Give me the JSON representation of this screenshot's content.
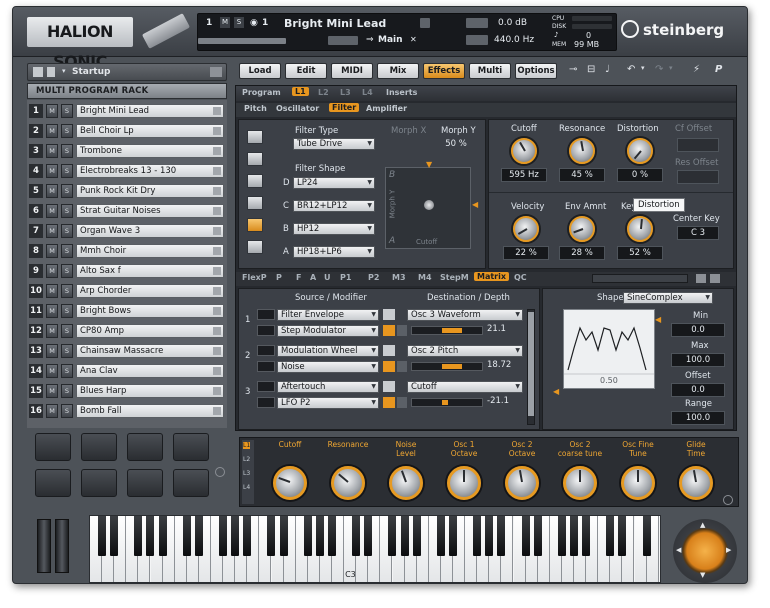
{
  "header": {
    "logo": "HALION SONIC",
    "slot_number": "1",
    "m_label": "M",
    "s_label": "S",
    "midi_channel": "1",
    "program_name": "Bright Mini Lead",
    "output": "Main",
    "level_db": "0.0 dB",
    "tune_hz": "440.0 Hz",
    "cpu_label": "CPU",
    "disk_label": "DISK",
    "midi_count": "0",
    "mem_label": "MEM",
    "mem_value": "99 MB",
    "brand": "steinberg"
  },
  "rack": {
    "preset_name": "Startup",
    "title": "MULTI PROGRAM RACK",
    "m_label": "M",
    "s_label": "S",
    "slots": [
      {
        "num": "1",
        "name": "Bright Mini Lead"
      },
      {
        "num": "2",
        "name": "Bell Choir Lp"
      },
      {
        "num": "3",
        "name": "Trombone"
      },
      {
        "num": "4",
        "name": "Electrobreaks 13 - 130"
      },
      {
        "num": "5",
        "name": "Punk Rock Kit Dry"
      },
      {
        "num": "6",
        "name": "Strat Guitar Noises"
      },
      {
        "num": "7",
        "name": "Organ Wave 3"
      },
      {
        "num": "8",
        "name": "Mmh Choir"
      },
      {
        "num": "9",
        "name": "Alto Sax f"
      },
      {
        "num": "10",
        "name": "Arp Chorder"
      },
      {
        "num": "11",
        "name": "Bright Bows"
      },
      {
        "num": "12",
        "name": "CP80 Amp"
      },
      {
        "num": "13",
        "name": "Chainsaw Massacre"
      },
      {
        "num": "14",
        "name": "Ana Clav"
      },
      {
        "num": "15",
        "name": "Blues Harp"
      },
      {
        "num": "16",
        "name": "Bomb Fall"
      }
    ]
  },
  "tabs": [
    "Load",
    "Edit",
    "MIDI",
    "Mix",
    "Effects",
    "Multi",
    "Options"
  ],
  "active_tab": "Effects",
  "editor": {
    "program_label": "Program",
    "layer_tabs": [
      "L1",
      "L2",
      "L3",
      "L4"
    ],
    "inserts_label": "Inserts",
    "sub_tabs": [
      "Pitch",
      "Oscillator",
      "Filter",
      "Amplifier"
    ],
    "active_sub_tab": "Filter",
    "filter_type_label": "Filter Type",
    "filter_type_value": "Tube Drive",
    "morph_x_label": "Morph X",
    "morph_y_label": "Morph Y",
    "morph_y_value": "50 %",
    "filter_shape_label": "Filter Shape",
    "shapes": [
      {
        "letter": "D",
        "value": "LP24"
      },
      {
        "letter": "C",
        "value": "BR12+LP12"
      },
      {
        "letter": "B",
        "value": "HP12"
      },
      {
        "letter": "A",
        "value": "HP18+LP6"
      }
    ],
    "xy_letters": [
      "B",
      "A"
    ],
    "xy_axis_y": "Morph Y",
    "xy_axis_x": "Cutoff",
    "knobs_top": [
      {
        "label": "Cutoff",
        "value": "595 Hz"
      },
      {
        "label": "Resonance",
        "value": "45 %"
      },
      {
        "label": "Distortion",
        "value": "0 %"
      }
    ],
    "cf_offset": "Cf Offset",
    "res_offset": "Res Offset",
    "knobs_bottom": [
      {
        "label": "Velocity",
        "value": "22 %"
      },
      {
        "label": "Env Amnt",
        "value": "28 %"
      },
      {
        "label": "Key",
        "value": "52 %"
      }
    ],
    "tooltip": "Distortion",
    "center_key_label": "Center Key",
    "center_key_value": "C 3",
    "mod_tabs": [
      "FlexP",
      "P",
      "F",
      "A",
      "U",
      "P1",
      "P2",
      "M3",
      "M4",
      "StepM",
      "Matrix",
      "QC"
    ],
    "active_mod_tab": "Matrix",
    "matrix": {
      "source_header": "Source / Modifier",
      "dest_header": "Destination / Depth",
      "rows": [
        {
          "num": "1",
          "source": "Filter Envelope",
          "modifier": "Step Modulator",
          "dest": "Osc 3 Waveform",
          "depth": "21.1"
        },
        {
          "num": "2",
          "source": "Modulation Wheel",
          "modifier": "Noise",
          "dest": "Osc 2 Pitch",
          "depth": "18.72"
        },
        {
          "num": "3",
          "source": "Aftertouch",
          "modifier": "LFO P2",
          "dest": "Cutoff",
          "depth": "-21.1"
        }
      ]
    },
    "shape_panel": {
      "shape_label": "Shape",
      "shape_value": "SineComplex",
      "min_label": "Min",
      "min_value": "0.0",
      "max_label": "Max",
      "max_value": "100.0",
      "offset_label": "Offset",
      "offset_value": "0.0",
      "range_label": "Range",
      "range_value": "100.0",
      "graph_value": "0.50"
    }
  },
  "quick_controls": {
    "layers": [
      "L1",
      "L2",
      "L3",
      "L4"
    ],
    "labels": [
      "Cutoff",
      "Resonance",
      "Noise\nLevel",
      "Osc 1\nOctave",
      "Osc 2\nOctave",
      "Osc 2\ncoarse tune",
      "Osc Fine\nTune",
      "Glide\nTime"
    ]
  },
  "keyboard": {
    "c3_label": "C3"
  },
  "colors": {
    "accent": "#e8961f",
    "panel": "#3c4047",
    "frame": "#4d5258"
  }
}
